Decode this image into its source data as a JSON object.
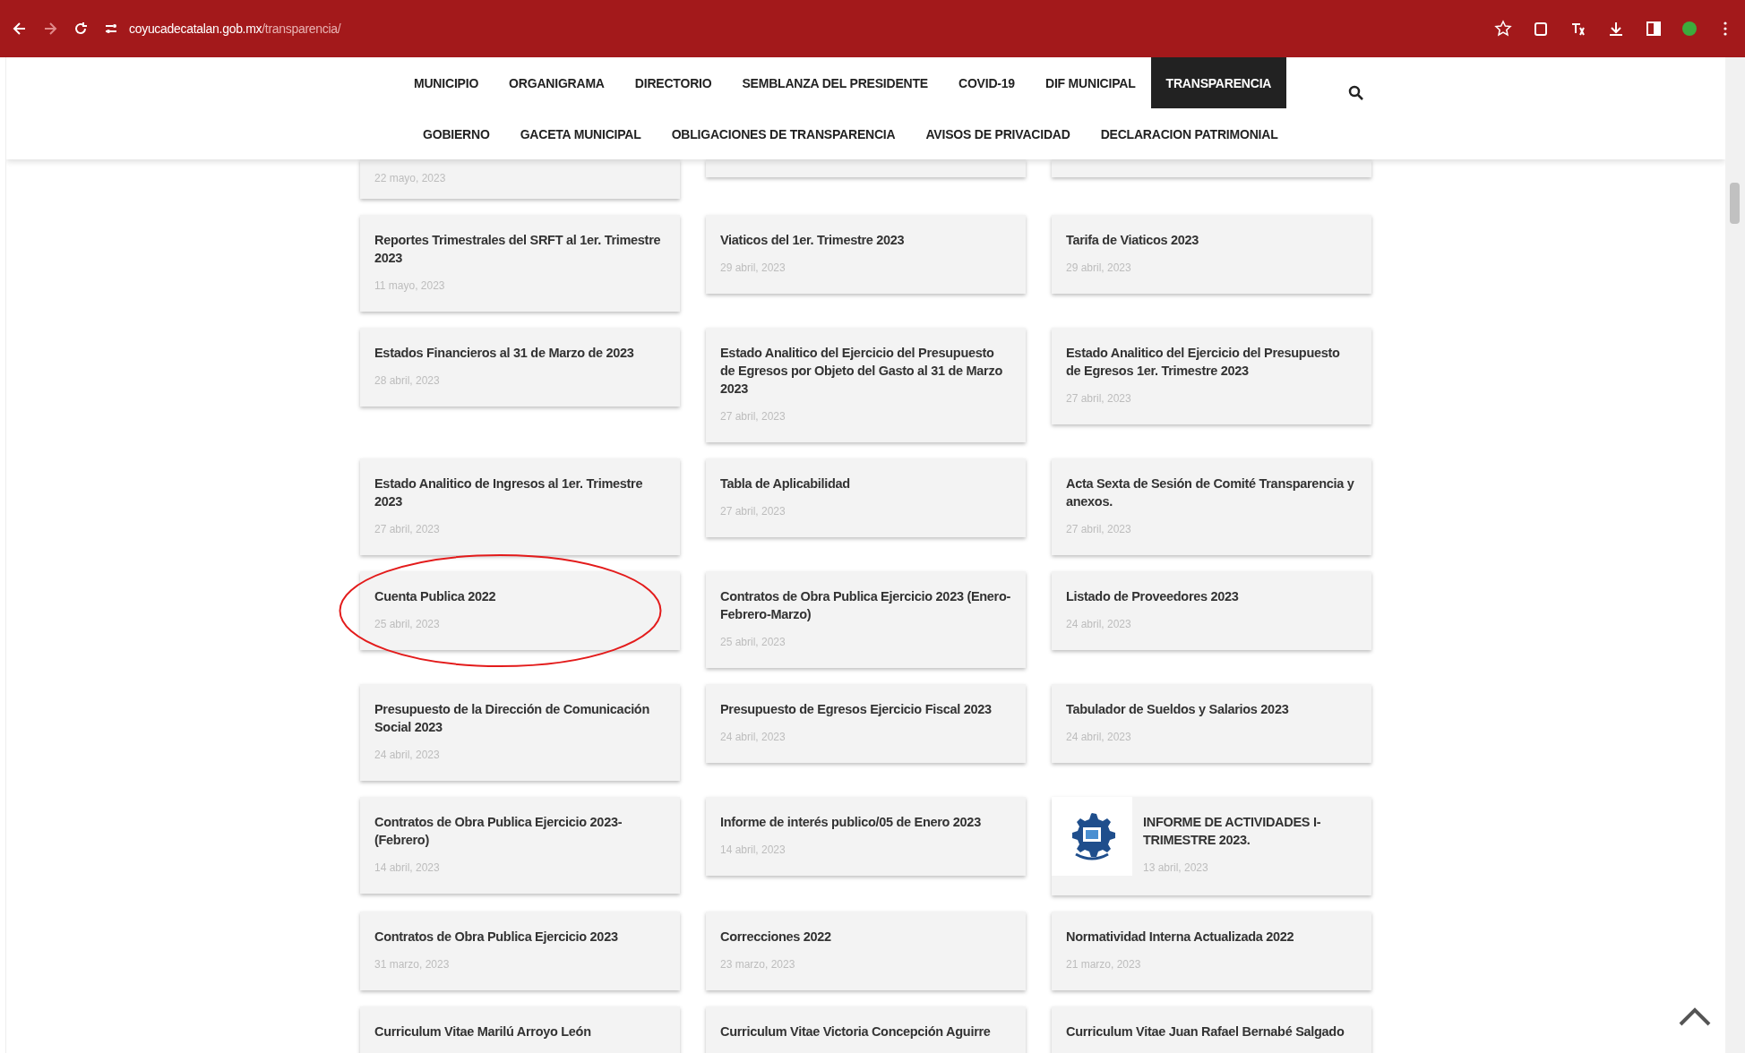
{
  "browser": {
    "url_domain": "coyucadecatalan.gob.mx",
    "url_path": "/transparencia/"
  },
  "nav": [
    [
      {
        "label": "MUNICIPIO",
        "selected": false
      },
      {
        "label": "ORGANIGRAMA",
        "selected": false
      },
      {
        "label": "DIRECTORIO",
        "selected": false
      },
      {
        "label": "SEMBLANZA DEL PRESIDENTE",
        "selected": false
      },
      {
        "label": "COVID-19",
        "selected": false
      },
      {
        "label": "DIF MUNICIPAL",
        "selected": false
      },
      {
        "label": "TRANSPARENCIA",
        "selected": true
      }
    ],
    [
      {
        "label": "GOBIERNO",
        "selected": false
      },
      {
        "label": "GACETA MUNICIPAL",
        "selected": false
      },
      {
        "label": "OBLIGACIONES DE TRANSPARENCIA",
        "selected": false
      },
      {
        "label": "AVISOS DE PRIVACIDAD",
        "selected": false
      },
      {
        "label": "DECLARACION PATRIMONIAL",
        "selected": false
      }
    ]
  ],
  "cards": [
    {
      "kind": "cut",
      "date": "22 mayo, 2023"
    },
    {
      "kind": "cut"
    },
    {
      "kind": "cut"
    },
    {
      "kind": "text",
      "title": "Reportes Trimestrales del SRFT al 1er. Trimestre 2023",
      "date": "11 mayo, 2023"
    },
    {
      "kind": "text",
      "title": "Viaticos del 1er. Trimestre 2023",
      "date": "29 abril, 2023"
    },
    {
      "kind": "text",
      "title": "Tarifa de Viaticos 2023",
      "date": "29 abril, 2023"
    },
    {
      "kind": "text",
      "title": "Estados Financieros al 31 de Marzo de 2023",
      "date": "28 abril, 2023"
    },
    {
      "kind": "text",
      "title": "Estado Analitico del Ejercicio del Presupuesto de Egresos por Objeto del Gasto al 31 de Marzo 2023",
      "date": "27 abril, 2023"
    },
    {
      "kind": "text",
      "title": "Estado Analitico del Ejercicio del Presupuesto de Egresos 1er. Trimestre 2023",
      "date": "27 abril, 2023"
    },
    {
      "kind": "text",
      "title": "Estado Analitico de Ingresos al 1er. Trimestre 2023",
      "date": "27 abril, 2023"
    },
    {
      "kind": "text",
      "title": "Tabla de Aplicabilidad",
      "date": "27 abril, 2023"
    },
    {
      "kind": "text",
      "title": "Acta Sexta de Sesión de Comité Transparencia y anexos.",
      "date": "27 abril, 2023"
    },
    {
      "kind": "text",
      "title": "Cuenta Publica 2022",
      "date": "25 abril, 2023",
      "circled": true
    },
    {
      "kind": "text",
      "title": "Contratos de Obra Publica Ejercicio 2023 (Enero-Febrero-Marzo)",
      "date": "25 abril, 2023"
    },
    {
      "kind": "text",
      "title": "Listado de Proveedores 2023",
      "date": "24 abril, 2023"
    },
    {
      "kind": "text",
      "title": "Presupuesto de la Dirección de Comunicación Social 2023",
      "date": "24 abril, 2023"
    },
    {
      "kind": "text",
      "title": "Presupuesto de Egresos Ejercicio Fiscal 2023",
      "date": "24 abril, 2023"
    },
    {
      "kind": "text",
      "title": "Tabulador de Sueldos y Salarios 2023",
      "date": "24 abril, 2023"
    },
    {
      "kind": "text",
      "title": "Contratos de Obra Publica Ejercicio 2023-(Febrero)",
      "date": "14 abril, 2023"
    },
    {
      "kind": "text",
      "title": "Informe de interés publico/05 de Enero 2023",
      "date": "14 abril, 2023"
    },
    {
      "kind": "thumb",
      "title": "INFORME DE ACTIVIDADES I-TRIMESTRE 2023.",
      "date": "13 abril, 2023"
    },
    {
      "kind": "text",
      "title": "Contratos de Obra Publica Ejercicio 2023",
      "date": "31 marzo, 2023"
    },
    {
      "kind": "text",
      "title": "Correcciones 2022",
      "date": "23 marzo, 2023"
    },
    {
      "kind": "text",
      "title": "Normatividad Interna Actualizada 2022",
      "date": "21 marzo, 2023"
    },
    {
      "kind": "text",
      "title": "Curriculum Vitae Marilú Arroyo León"
    },
    {
      "kind": "text",
      "title": "Curriculum Vitae Victoria Concepción Aguirre"
    },
    {
      "kind": "text",
      "title": "Curriculum Vitae Juan Rafael Bernabé Salgado"
    }
  ]
}
